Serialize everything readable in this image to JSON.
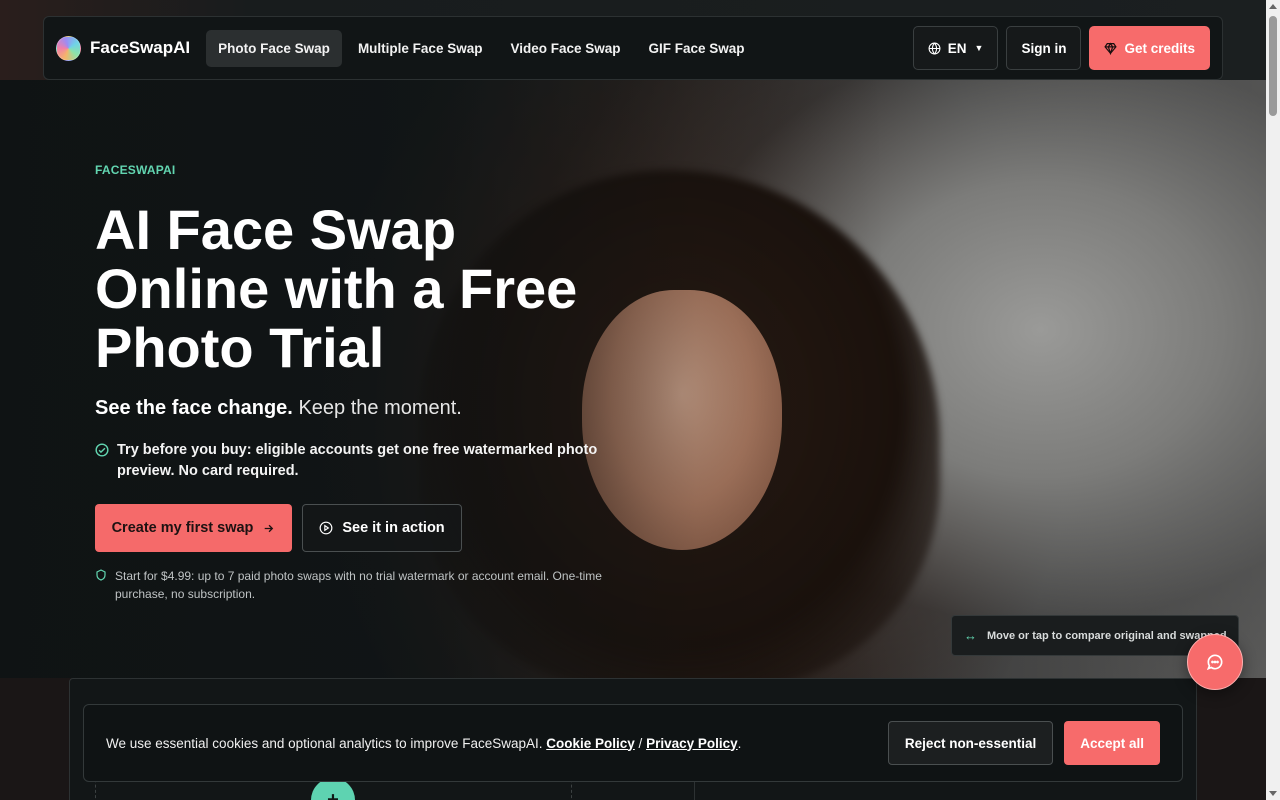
{
  "brand": {
    "name": "FaceSwapAI"
  },
  "nav": {
    "links": [
      {
        "label": "Photo Face Swap",
        "active": true
      },
      {
        "label": "Multiple Face Swap"
      },
      {
        "label": "Video Face Swap"
      },
      {
        "label": "GIF Face Swap"
      }
    ],
    "language": "EN",
    "sign_in": "Sign in",
    "get_credits": "Get credits"
  },
  "hero": {
    "eyebrow": "FACESWAPAI",
    "headline": "AI Face Swap Online with a Free Photo Trial",
    "subhead_bold": "See the face change.",
    "subhead_light": "Keep the moment.",
    "trial_note": "Try before you buy: eligible accounts get one free watermarked photo preview. No card required.",
    "cta_primary": "Create my first swap",
    "cta_secondary": "See it in action",
    "pricing_note": "Start for $4.99: up to 7 paid photo swaps with no trial watermark or account email. One-time purchase, no subscription.",
    "compare_hint": "Move or tap to compare original and swapped"
  },
  "cookie": {
    "text": "We use essential cookies and optional analytics to improve FaceSwapAI.",
    "cookie_policy": "Cookie Policy",
    "separator": "/",
    "privacy_policy": "Privacy Policy",
    "period": ".",
    "reject": "Reject non-essential",
    "accept": "Accept all"
  },
  "colors": {
    "accent": "#f76b6b",
    "teal": "#62d5b0",
    "background": "#0f1314"
  }
}
